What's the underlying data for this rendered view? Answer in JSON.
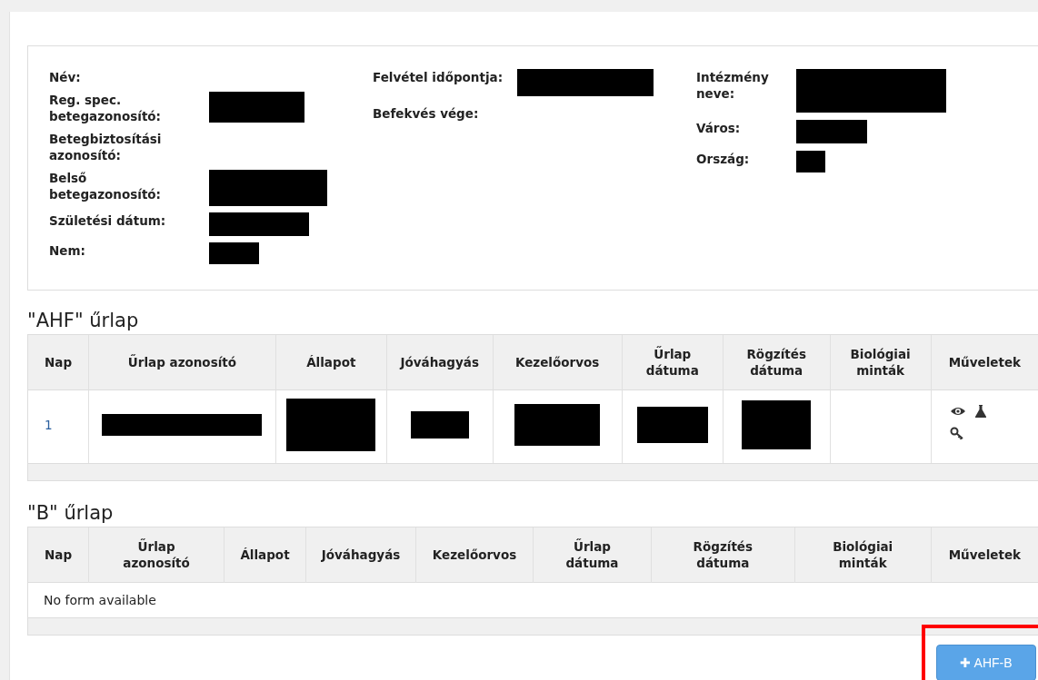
{
  "patient_card": {
    "columns": [
      [
        {
          "label": "Név:",
          "redacted": false
        },
        {
          "label": "Reg. spec. betegazonosító:",
          "redacted": true
        },
        {
          "label": "Betegbiztosítási azonosító:",
          "redacted": false
        },
        {
          "label": "Belső betegazonosító:",
          "redacted": true
        },
        {
          "label": "Születési dátum:",
          "redacted": true
        },
        {
          "label": "Nem:",
          "redacted": true
        }
      ],
      [
        {
          "label": "Felvétel időpontja:",
          "redacted": true
        },
        {
          "label": "Befekvés vége:",
          "redacted": false
        }
      ],
      [
        {
          "label": "Intézmény neve:",
          "redacted": true
        },
        {
          "label": "Város:",
          "redacted": true
        },
        {
          "label": "Ország:",
          "redacted": true
        }
      ]
    ]
  },
  "tables": [
    {
      "title": "\"AHF\" űrlap",
      "columns": [
        "Nap",
        "Űrlap azonosító",
        "Állapot",
        "Jóváhagyás",
        "Kezelőorvos",
        "Űrlap dátuma",
        "Rögzítés dátuma",
        "Biológiai minták",
        "Műveletek"
      ],
      "rows": [
        {
          "cells": [
            {
              "text": "1",
              "redacted": false
            },
            {
              "redacted": true
            },
            {
              "redacted": true
            },
            {
              "redacted": true
            },
            {
              "redacted": true
            },
            {
              "redacted": true
            },
            {
              "redacted": true
            },
            {
              "redacted": false
            }
          ],
          "actions": [
            {
              "kind": "view"
            },
            {
              "kind": "sample"
            },
            {
              "kind": "key"
            }
          ]
        }
      ]
    },
    {
      "title": "\"B\" űrlap",
      "columns": [
        "Nap",
        "Űrlap azonosító",
        "Állapot",
        "Jóváhagyás",
        "Kezelőorvos",
        "Űrlap dátuma",
        "Rögzítés dátuma",
        "Biológiai minták",
        "Műveletek"
      ],
      "empty_message": "No form available"
    }
  ],
  "add_button": {
    "icon": "✚",
    "label": "AHF-B",
    "highlighted": true
  }
}
